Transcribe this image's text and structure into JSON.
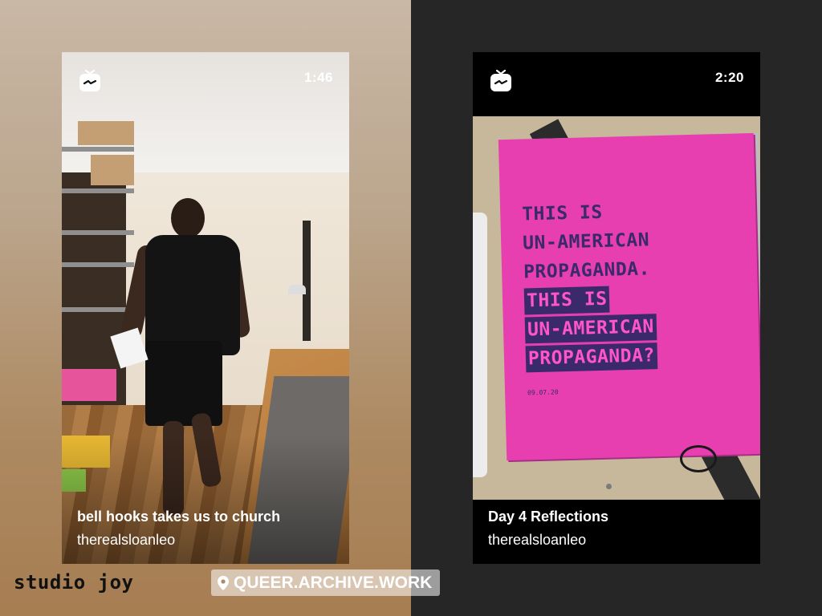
{
  "left_video": {
    "duration": "1:46",
    "title": "bell hooks takes us to church",
    "username": "therealsloanleo",
    "icon": "igtv-icon"
  },
  "right_video": {
    "duration": "2:20",
    "title": "Day 4 Reflections",
    "username": "therealsloanleo",
    "icon": "igtv-icon",
    "poster_text": {
      "plain_lines": [
        "THIS IS",
        "UN-AMERICAN",
        "PROPAGANDA."
      ],
      "highlight_lines": [
        "THIS IS",
        "UN-AMERICAN",
        "PROPAGANDA?"
      ],
      "date": "09.07.20"
    }
  },
  "overlays": {
    "sticker_text": "studio joy",
    "location_tag": "QUEER.ARCHIVE.WORK",
    "location_icon": "location-pin-icon"
  },
  "colors": {
    "poster_pink": "#e83fb0",
    "poster_ink": "#3b2a6b",
    "left_background": "#bba58c",
    "right_background": "#262626"
  }
}
